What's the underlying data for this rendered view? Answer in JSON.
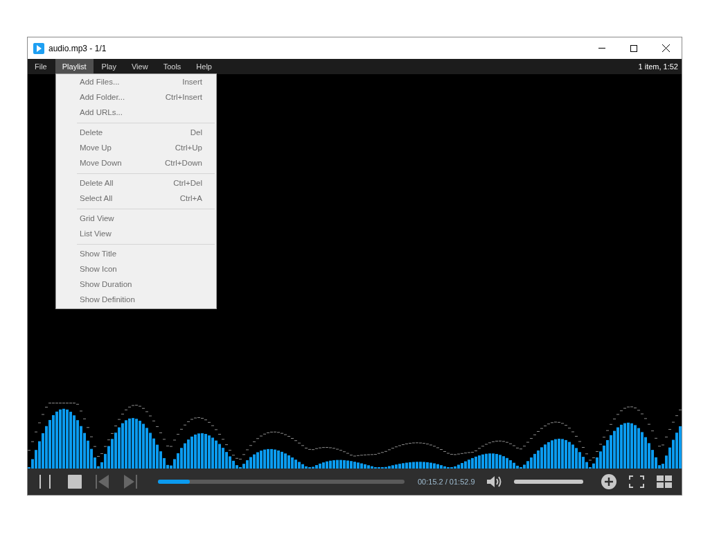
{
  "window": {
    "title": "audio.mp3 - 1/1"
  },
  "menu_bar": {
    "items": [
      {
        "label": "File",
        "selected": false
      },
      {
        "label": "Playlist",
        "selected": true
      },
      {
        "label": "Play",
        "selected": false
      },
      {
        "label": "View",
        "selected": false
      },
      {
        "label": "Tools",
        "selected": false
      },
      {
        "label": "Help",
        "selected": false
      }
    ],
    "status": "1 item, 1:52"
  },
  "playlist_menu": {
    "groups": [
      [
        {
          "label": "Add Files...",
          "shortcut": "Insert"
        },
        {
          "label": "Add Folder...",
          "shortcut": "Ctrl+Insert"
        },
        {
          "label": "Add URLs..."
        }
      ],
      [
        {
          "label": "Delete",
          "shortcut": "Del"
        },
        {
          "label": "Move Up",
          "shortcut": "Ctrl+Up"
        },
        {
          "label": "Move Down",
          "shortcut": "Ctrl+Down"
        }
      ],
      [
        {
          "label": "Delete All",
          "shortcut": "Ctrl+Del"
        },
        {
          "label": "Select All",
          "shortcut": "Ctrl+A"
        }
      ],
      [
        {
          "label": "Grid View"
        },
        {
          "label": "List View"
        }
      ],
      [
        {
          "label": "Show Title"
        },
        {
          "label": "Show Icon"
        },
        {
          "label": "Show Duration"
        },
        {
          "label": "Show Definition"
        }
      ]
    ]
  },
  "controls": {
    "seek": {
      "level": 0.13
    },
    "time": "00:15.2 / 01:52.9",
    "volume": {
      "level": 1
    }
  }
}
